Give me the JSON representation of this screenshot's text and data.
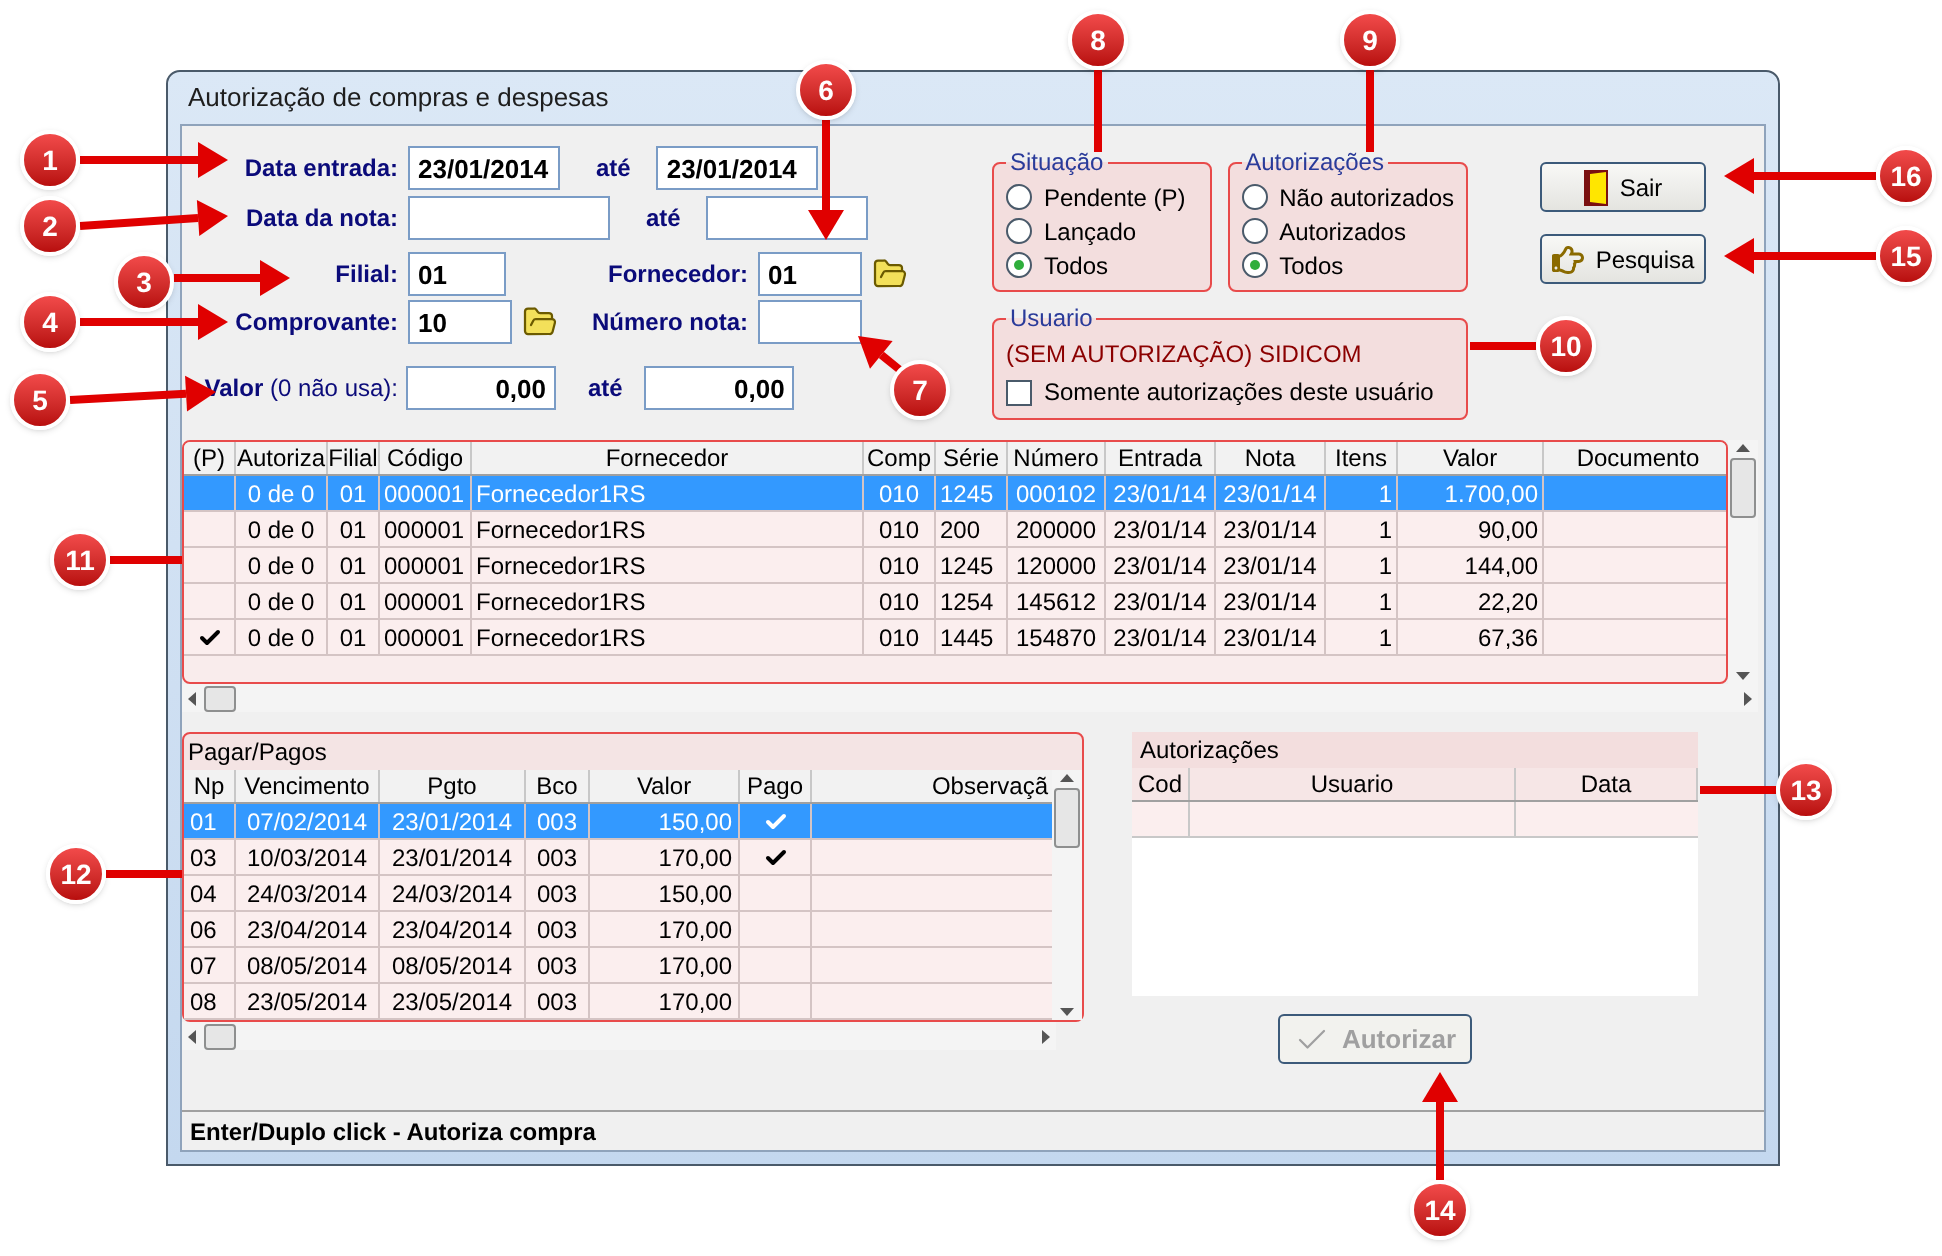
{
  "window": {
    "title": "Autorização de compras e despesas"
  },
  "date_entry": {
    "label": "Data entrada:",
    "value": "23/01/2014",
    "to_label": "até",
    "to_value": "23/01/2014"
  },
  "note_date": {
    "label": "Data da nota:",
    "to_label": "até"
  },
  "branch": {
    "label": "Filial:",
    "value": "01"
  },
  "supplier": {
    "label": "Fornecedor:",
    "value": "01"
  },
  "voucher": {
    "label": "Comprovante:",
    "value": "10"
  },
  "note_number": {
    "label": "Número nota:"
  },
  "amount": {
    "label": "**Valor** (0 não usa):",
    "value": "0,00",
    "to_label": "até",
    "to_value": "0,00"
  },
  "situacao": {
    "title": "Situação",
    "options": [
      {
        "label": "Pendente (P)",
        "selected": false
      },
      {
        "label": "Lançado",
        "selected": false
      },
      {
        "label": "Todos",
        "selected": true
      }
    ]
  },
  "authorization_filter": {
    "title": "Autorizações",
    "options": [
      {
        "label": "Não autorizados",
        "selected": false
      },
      {
        "label": "Autorizados",
        "selected": false
      },
      {
        "label": "Todos",
        "selected": true
      }
    ]
  },
  "user": {
    "title": "Usuario",
    "name": "(SEM AUTORIZAÇÃO) SIDICOM",
    "checkbox": {
      "label": "Somente autorizações deste usuário",
      "checked": false
    }
  },
  "buttons": [
    {
      "label": "Sair",
      "kind": "exit"
    },
    {
      "label": "Pesquisa",
      "kind": "search"
    }
  ],
  "purchases": {
    "columns": [
      "(P)",
      "Autoriza",
      "Filial",
      "Código",
      "Fornecedor",
      "Comp",
      "Série",
      "Número",
      "Entrada",
      "Nota",
      "Itens",
      "Valor",
      "Documento"
    ],
    "rows": [
      {
        "selected": true,
        "checked": false,
        "cells": [
          "",
          "0 de 0",
          "01",
          "000001",
          "Fornecedor1RS",
          "010",
          "1245",
          "000102",
          "23/01/14",
          "23/01/14",
          "1",
          "1.700,00"
        ]
      },
      {
        "selected": false,
        "checked": false,
        "cells": [
          "",
          "0 de 0",
          "01",
          "000001",
          "Fornecedor1RS",
          "010",
          "200",
          "200000",
          "23/01/14",
          "23/01/14",
          "1",
          "90,00"
        ]
      },
      {
        "selected": false,
        "checked": false,
        "cells": [
          "",
          "0 de 0",
          "01",
          "000001",
          "Fornecedor1RS",
          "010",
          "1245",
          "120000",
          "23/01/14",
          "23/01/14",
          "1",
          "144,00"
        ]
      },
      {
        "selected": false,
        "checked": false,
        "cells": [
          "",
          "0 de 0",
          "01",
          "000001",
          "Fornecedor1RS",
          "010",
          "1254",
          "145612",
          "23/01/14",
          "23/01/14",
          "1",
          "22,20"
        ]
      },
      {
        "selected": false,
        "checked": true,
        "cells": [
          "",
          "0 de 0",
          "01",
          "000001",
          "Fornecedor1RS",
          "010",
          "1445",
          "154870",
          "23/01/14",
          "23/01/14",
          "1",
          "67,36"
        ]
      }
    ]
  },
  "payments": {
    "title": "Pagar/Pagos",
    "columns": [
      "Np",
      "Vencimento",
      "Pgto",
      "Bco",
      "Valor",
      "Pago",
      "Observaçã"
    ],
    "rows": [
      {
        "selected": true,
        "paid": true,
        "cells": [
          "01",
          "07/02/2014",
          "23/01/2014",
          "003",
          "150,00"
        ]
      },
      {
        "selected": false,
        "paid": true,
        "cells": [
          "03",
          "10/03/2014",
          "23/01/2014",
          "003",
          "170,00"
        ]
      },
      {
        "selected": false,
        "paid": false,
        "cells": [
          "04",
          "24/03/2014",
          "24/03/2014",
          "003",
          "150,00"
        ]
      },
      {
        "selected": false,
        "paid": false,
        "cells": [
          "06",
          "23/04/2014",
          "23/04/2014",
          "003",
          "170,00"
        ]
      },
      {
        "selected": false,
        "paid": false,
        "cells": [
          "07",
          "08/05/2014",
          "08/05/2014",
          "003",
          "170,00"
        ]
      },
      {
        "selected": false,
        "paid": false,
        "cells": [
          "08",
          "23/05/2014",
          "23/05/2014",
          "003",
          "170,00"
        ]
      }
    ]
  },
  "authorizations": {
    "title": "Autorizações",
    "columns": [
      "Cod",
      "Usuario",
      "Data"
    ]
  },
  "authorize_button": {
    "label": "Autorizar",
    "disabled": true
  },
  "status_bar": "Enter/Duplo click - Autoriza compra",
  "callouts": [
    "1",
    "2",
    "3",
    "4",
    "5",
    "6",
    "7",
    "8",
    "9",
    "10",
    "11",
    "12",
    "13",
    "14",
    "15",
    "16"
  ]
}
